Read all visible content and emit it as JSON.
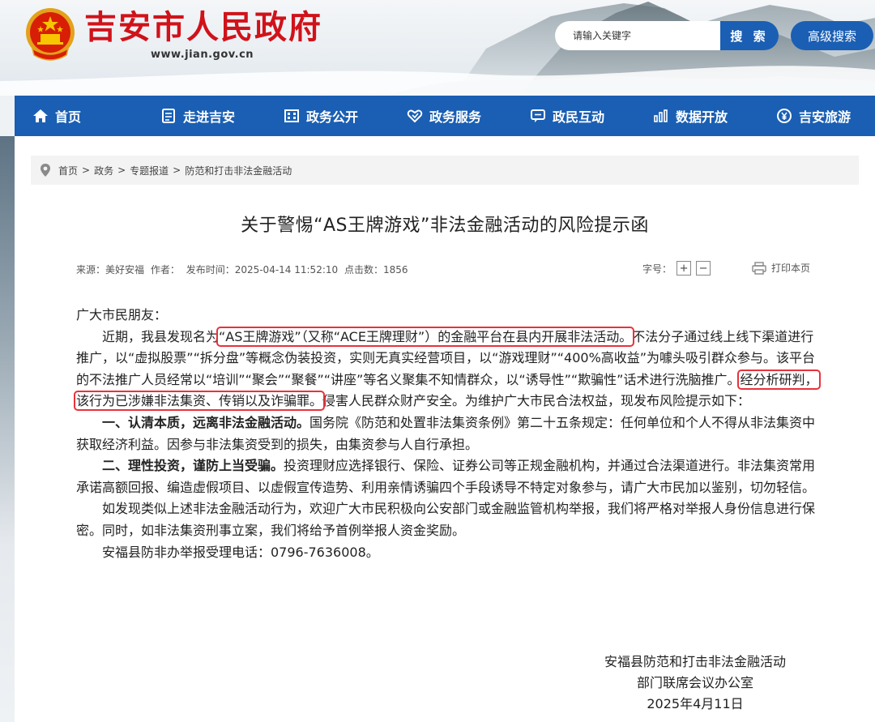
{
  "header": {
    "site_title": "吉安市人民政府",
    "site_url": "www.jian.gov.cn",
    "search_placeholder": "请输入关键字",
    "search_label": "搜 索",
    "advanced_search_label": "高级搜索"
  },
  "nav": {
    "items": [
      {
        "label": "首页",
        "icon": "home-icon"
      },
      {
        "label": "走进吉安",
        "icon": "book-icon"
      },
      {
        "label": "政务公开",
        "icon": "building-icon"
      },
      {
        "label": "政务服务",
        "icon": "heart-icon"
      },
      {
        "label": "政民互动",
        "icon": "chat-icon"
      },
      {
        "label": "数据开放",
        "icon": "bar-chart-icon"
      },
      {
        "label": "吉安旅游",
        "icon": "yen-circle-icon"
      }
    ]
  },
  "breadcrumb": {
    "items": [
      "首页",
      "政务",
      "专题报道",
      "防范和打击非法金融活动"
    ],
    "separator": ">"
  },
  "article": {
    "title": "关于警惕“AS王牌游戏”非法金融活动的风险提示函",
    "meta": {
      "source": "来源：美好安福",
      "author": "作者：",
      "published": "发布时间：2025-04-14 11:52:10",
      "clicks": "点击数：1856"
    },
    "font_size_label": "字号：",
    "font_plus": "+",
    "font_minus": "−",
    "print_label": "打印本页",
    "greeting": "广大市民朋友：",
    "p1_lead": "近期，我县发现名为",
    "p1_highlight": "“AS王牌游戏”（又称“ACE王牌理财”）的金融平台在县内开展非法活动。",
    "p1_mid": "不法分子通过线上线下渠道进行推广，以“虚拟股票”“拆分盘”等概念伪装投资，实则无真实经营项目，以“游戏理财”“400%高收益”为噱头吸引群众参与。该平台的不法推广人员经常以“培训”“聚会”“聚餐”“讲座”等名义聚集不知情群众，以“诱导性”“欺骗性”话术进行洗脑推广。",
    "p1_highlight2": "经分析研判，该行为已涉嫌非法集资、传销以及诈骗罪。",
    "p1_tail": "侵害人民群众财产安全。为维护广大市民合法权益，现发布风险提示如下：",
    "p2_bold": "一、认清本质，远离非法金融活动。",
    "p2_text": "国务院《防范和处置非法集资条例》第二十五条规定：任何单位和个人不得从非法集资中获取经济利益。因参与非法集资受到的损失，由集资参与人自行承担。",
    "p3_bold": "二、理性投资，谨防上当受骗。",
    "p3_text": "投资理财应选择银行、保险、证券公司等正规金融机构，并通过合法渠道进行。非法集资常用承诺高额回报、编造虚假项目、以虚假宣传造势、利用亲情诱骗四个手段诱导不特定对象参与，请广大市民加以鉴别，切勿轻信。",
    "p4": "如发现类似上述非法金融活动行为，欢迎广大市民积极向公安部门或金融监管机构举报，我们将严格对举报人身份信息进行保密。同时，如非法集资刑事立案，我们将给予首例举报人资金奖励。",
    "p5": "安福县防非办举报受理电话：0796-7636008。",
    "sign_line1": "安福县防范和打击非法金融活动",
    "sign_line2": "部门联席会议办公室",
    "sign_date": "2025年4月11日"
  },
  "colors": {
    "brand_red": "#d0121a",
    "nav_blue": "#1a5fb4",
    "highlight_red": "#e8323c"
  }
}
